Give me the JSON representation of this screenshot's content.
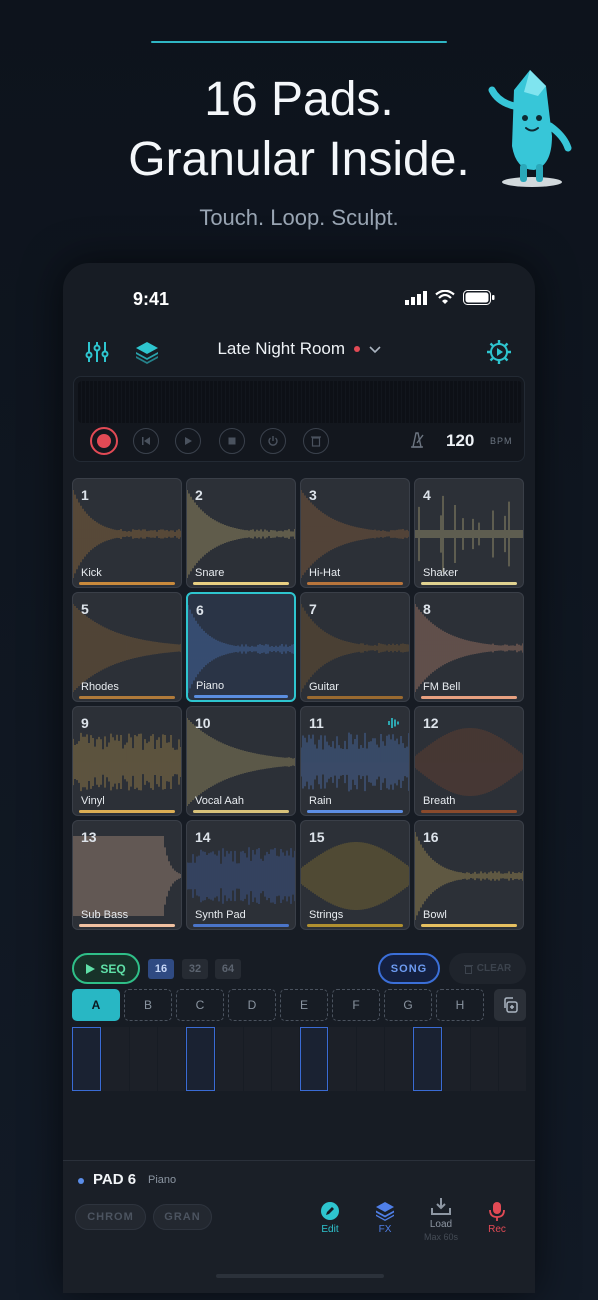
{
  "hero": {
    "title_line1": "16 Pads.",
    "title_line2": "Granular Inside.",
    "subtitle": "Touch. Loop. Sculpt."
  },
  "status": {
    "time": "9:41"
  },
  "header": {
    "project_name": "Late Night Room"
  },
  "transport": {
    "bpm": "120",
    "bpm_unit": "BPM"
  },
  "pads": [
    {
      "num": "1",
      "name": "Kick",
      "color": "#c98a3c"
    },
    {
      "num": "2",
      "name": "Snare",
      "color": "#e8cf82"
    },
    {
      "num": "3",
      "name": "Hi-Hat",
      "color": "#b8753c"
    },
    {
      "num": "4",
      "name": "Shaker",
      "color": "#e0d290"
    },
    {
      "num": "5",
      "name": "Rhodes",
      "color": "#b07a3a"
    },
    {
      "num": "6",
      "name": "Piano",
      "color": "#5b8ee0"
    },
    {
      "num": "7",
      "name": "Guitar",
      "color": "#9a6a30"
    },
    {
      "num": "8",
      "name": "FM Bell",
      "color": "#e8a080"
    },
    {
      "num": "9",
      "name": "Vinyl",
      "color": "#dcae54"
    },
    {
      "num": "10",
      "name": "Vocal Aah",
      "color": "#d8c27a"
    },
    {
      "num": "11",
      "name": "Rain",
      "color": "#5d8ee4"
    },
    {
      "num": "12",
      "name": "Breath",
      "color": "#8a4a2c"
    },
    {
      "num": "13",
      "name": "Sub Bass",
      "color": "#f0c0a0"
    },
    {
      "num": "14",
      "name": "Synth Pad",
      "color": "#4a74c8"
    },
    {
      "num": "15",
      "name": "Strings",
      "color": "#b09030"
    },
    {
      "num": "16",
      "name": "Bowl",
      "color": "#e6c060"
    }
  ],
  "sequencer": {
    "seq_label": "SEQ",
    "lengths": [
      "16",
      "32",
      "64"
    ],
    "active_length": "16",
    "song_label": "SONG",
    "clear_label": "CLEAR",
    "patterns": [
      "A",
      "B",
      "C",
      "D",
      "E",
      "F",
      "G",
      "H"
    ],
    "active_pattern": "A"
  },
  "footer": {
    "pad_label": "PAD 6",
    "pad_sample": "Piano",
    "modes": [
      "CHROM",
      "GRAN"
    ],
    "tools": [
      {
        "label": "Edit",
        "icon": "edit-icon",
        "color": "#2ec5cf"
      },
      {
        "label": "FX",
        "icon": "layers-icon",
        "color": "#4f7fe8"
      },
      {
        "label": "Load",
        "sub": "Max 60s",
        "icon": "load-icon",
        "color": "#8e97a3"
      },
      {
        "label": "Rec",
        "icon": "mic-icon",
        "color": "#e24a55"
      }
    ]
  },
  "colors": {
    "accent": "#2ec5cf",
    "record": "#e24a55",
    "seq_green": "#2fbf88",
    "song_blue": "#3b6fd8"
  }
}
